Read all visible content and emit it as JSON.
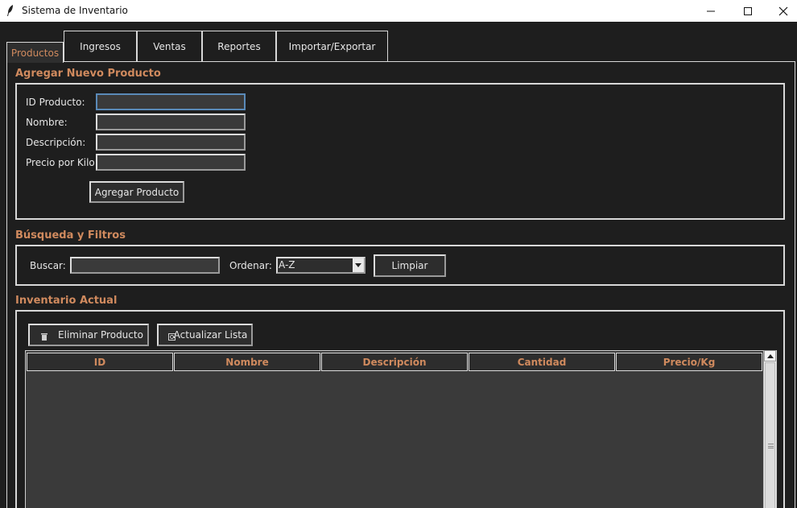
{
  "window": {
    "title": "Sistema de Inventario"
  },
  "tabs": [
    {
      "label": "Productos"
    },
    {
      "label": "Ingresos"
    },
    {
      "label": "Ventas"
    },
    {
      "label": "Reportes"
    },
    {
      "label": "Importar/Exportar"
    }
  ],
  "add_product": {
    "title": "Agregar Nuevo Producto",
    "fields": [
      {
        "label": "ID Producto:",
        "value": ""
      },
      {
        "label": "Nombre:",
        "value": ""
      },
      {
        "label": "Descripción:",
        "value": ""
      },
      {
        "label": "Precio por Kilo:",
        "value": ""
      }
    ],
    "submit_label": "Agregar Producto"
  },
  "search": {
    "title": "Búsqueda y Filtros",
    "search_label": "Buscar:",
    "search_value": "",
    "sort_label": "Ordenar:",
    "sort_value": "A-Z",
    "clear_label": "Limpiar"
  },
  "inventory": {
    "title": "Inventario Actual",
    "delete_label": "Eliminar Producto",
    "refresh_label": "Actualizar Lista",
    "columns": [
      "ID",
      "Nombre",
      "Descripción",
      "Cantidad",
      "Precio/Kg"
    ],
    "rows": []
  },
  "colors": {
    "accent": "#d08a5e",
    "background": "#1e1e1e",
    "field": "#3a3a3a",
    "border": "#d8d8d8"
  },
  "icons": {
    "app": "feather-icon",
    "delete": "trash-icon",
    "refresh": "refresh-icon"
  }
}
